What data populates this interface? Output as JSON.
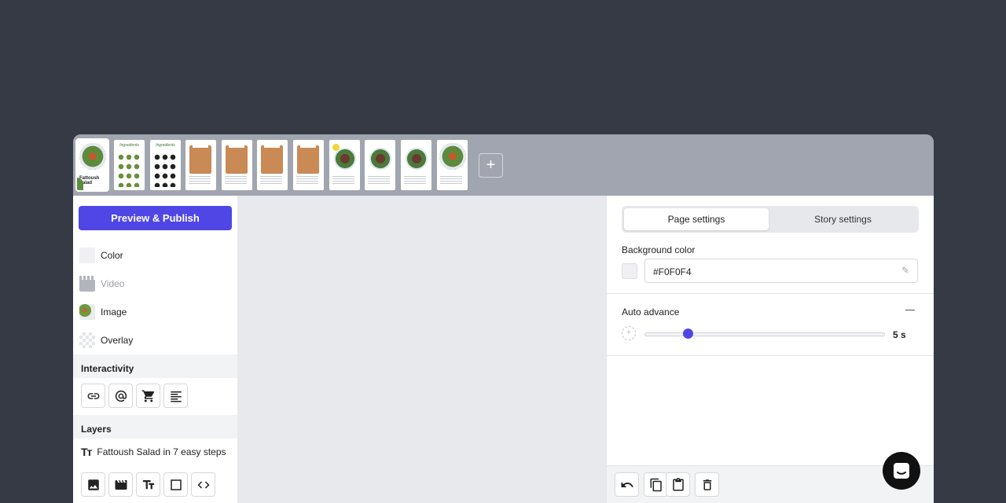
{
  "thumbnails": [
    {
      "kind": "cover",
      "title": "Fattoush Salad"
    },
    {
      "kind": "ingredients",
      "heading": "Ingredients",
      "dots": "green"
    },
    {
      "kind": "ingredients",
      "heading": "Ingredients",
      "dots": "dark"
    },
    {
      "kind": "board"
    },
    {
      "kind": "board"
    },
    {
      "kind": "board"
    },
    {
      "kind": "board"
    },
    {
      "kind": "bowl"
    },
    {
      "kind": "bowl"
    },
    {
      "kind": "bowl"
    },
    {
      "kind": "cover-end"
    }
  ],
  "add_page_label": "+",
  "left_panel": {
    "publish_label": "Preview & Publish",
    "background_items": [
      {
        "label": "Color",
        "icon": "color-swatch-icon",
        "muted": false
      },
      {
        "label": "Video",
        "icon": "video-icon",
        "muted": true
      },
      {
        "label": "Image",
        "icon": "image-thumbnail-icon",
        "muted": false
      },
      {
        "label": "Overlay",
        "icon": "overlay-icon",
        "muted": false
      }
    ],
    "interactivity_title": "Interactivity",
    "interactivity_tools": [
      "link-icon",
      "at-sign-icon",
      "cart-icon",
      "text-align-icon"
    ],
    "layers_title": "Layers",
    "layer_icon_text": "Tт",
    "layers": [
      {
        "label": "Fattoush Salad in 7 easy steps",
        "icon": "text-layer-icon"
      }
    ],
    "add_tools": [
      "image-icon",
      "video-icon",
      "text-icon",
      "shape-icon",
      "code-icon"
    ]
  },
  "right_panel": {
    "tabs": {
      "page": "Page settings",
      "story": "Story settings"
    },
    "background_color_label": "Background color",
    "background_color_value": "#F0F0F4",
    "auto_advance_label": "Auto advance",
    "auto_advance_value": "5 s",
    "auto_advance_fraction": 0.18,
    "bottom_tools": [
      "undo-icon",
      "copy-icon",
      "paste-icon",
      "delete-icon"
    ]
  },
  "colors": {
    "accent": "#4f46e5",
    "strip": "#a1a5af",
    "page_bg": "#363a44"
  }
}
